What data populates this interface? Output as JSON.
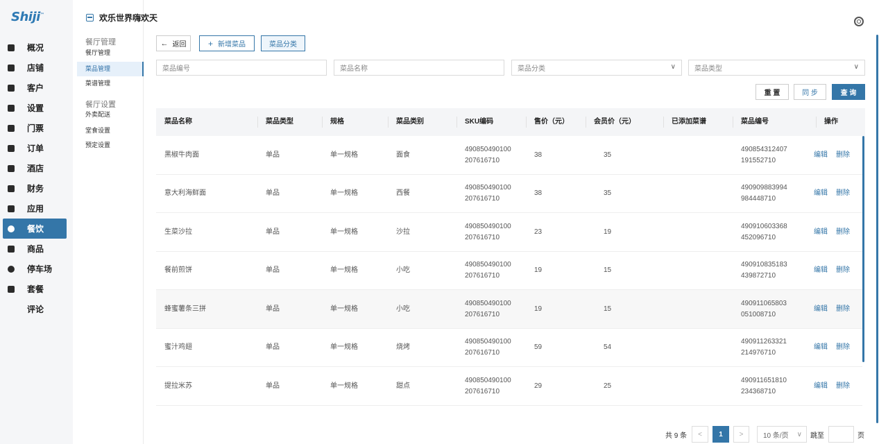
{
  "app": {
    "logo": "Shiji",
    "settings_icon": "gear-icon"
  },
  "nav": {
    "items": [
      {
        "label": "概况",
        "icon": "overview-icon",
        "active": false
      },
      {
        "label": "店铺",
        "icon": "store-icon",
        "active": false
      },
      {
        "label": "客户",
        "icon": "customer-icon",
        "active": false
      },
      {
        "label": "设置",
        "icon": "settings-icon",
        "active": false
      },
      {
        "label": "门票",
        "icon": "ticket-icon",
        "active": false
      },
      {
        "label": "订单",
        "icon": "order-icon",
        "active": false
      },
      {
        "label": "酒店",
        "icon": "hotel-icon",
        "active": false
      },
      {
        "label": "财务",
        "icon": "finance-icon",
        "active": false
      },
      {
        "label": "应用",
        "icon": "apps-icon",
        "active": false
      },
      {
        "label": "餐饮",
        "icon": "dining-icon",
        "active": true
      },
      {
        "label": "商品",
        "icon": "goods-icon",
        "active": false
      },
      {
        "label": "停车场",
        "icon": "parking-icon",
        "active": false
      },
      {
        "label": "套餐",
        "icon": "package-icon",
        "active": false
      },
      {
        "label": "评论",
        "icon": "",
        "active": false
      }
    ]
  },
  "page_title": "欢乐世界嗨欢天",
  "subnav": {
    "group1": {
      "title": "餐厅管理",
      "items": [
        "餐厅管理",
        "菜品管理",
        "菜谱管理"
      ],
      "active_index": 1
    },
    "group2": {
      "title": "餐厅设置",
      "items": [
        "外卖配送",
        "堂食设置",
        "预定设置"
      ]
    }
  },
  "toolbar": {
    "back_label": "返回",
    "add_label": "新增菜品",
    "category_label": "菜品分类"
  },
  "filters": {
    "code_placeholder": "菜品编号",
    "name_placeholder": "菜品名称",
    "category_placeholder": "菜品分类",
    "type_placeholder": "菜品类型"
  },
  "actions": {
    "reset_label": "重 置",
    "sync_label": "同 步",
    "query_label": "查 询"
  },
  "table": {
    "headers": [
      "菜品名称",
      "菜品类型",
      "规格",
      "菜品类别",
      "SKU编码",
      "售价（元）",
      "会员价（元）",
      "已添加菜谱",
      "菜品编号",
      "操作"
    ],
    "edit_label": "编辑",
    "delete_label": "删除",
    "rows": [
      {
        "name": "黑椒牛肉面",
        "type": "单品",
        "spec": "单一规格",
        "category": "面食",
        "sku_1": "490850490100",
        "sku_2": "207616710",
        "price": "38",
        "member_price": "35",
        "menu": "",
        "code_1": "490854312407",
        "code_2": "191552710"
      },
      {
        "name": "意大利海鲜面",
        "type": "单品",
        "spec": "单一规格",
        "category": "西餐",
        "sku_1": "490850490100",
        "sku_2": "207616710",
        "price": "38",
        "member_price": "35",
        "menu": "",
        "code_1": "490909883994",
        "code_2": "984448710"
      },
      {
        "name": "生菜沙拉",
        "type": "单品",
        "spec": "单一规格",
        "category": "沙拉",
        "sku_1": "490850490100",
        "sku_2": "207616710",
        "price": "23",
        "member_price": "19",
        "menu": "",
        "code_1": "490910603368",
        "code_2": "452096710"
      },
      {
        "name": "餐前煎饼",
        "type": "单品",
        "spec": "单一规格",
        "category": "小吃",
        "sku_1": "490850490100",
        "sku_2": "207616710",
        "price": "19",
        "member_price": "15",
        "menu": "",
        "code_1": "490910835183",
        "code_2": "439872710"
      },
      {
        "name": "蜂蜜薯条三拼",
        "type": "单品",
        "spec": "单一规格",
        "category": "小吃",
        "sku_1": "490850490100",
        "sku_2": "207616710",
        "price": "19",
        "member_price": "15",
        "menu": "",
        "code_1": "490911065803",
        "code_2": "051008710"
      },
      {
        "name": "蜜汁鸡翅",
        "type": "单品",
        "spec": "单一规格",
        "category": "烧烤",
        "sku_1": "490850490100",
        "sku_2": "207616710",
        "price": "59",
        "member_price": "54",
        "menu": "",
        "code_1": "490911263321",
        "code_2": "214976710"
      },
      {
        "name": "提拉米苏",
        "type": "单品",
        "spec": "单一规格",
        "category": "甜点",
        "sku_1": "490850490100",
        "sku_2": "207616710",
        "price": "29",
        "member_price": "25",
        "menu": "",
        "code_1": "490911651810",
        "code_2": "234368710"
      }
    ]
  },
  "pagination": {
    "total_text": "共 9 条",
    "current_page": "1",
    "prev": "<",
    "next": ">",
    "page_size": "10 条/页",
    "jump_label": "跳至",
    "page_suffix": "页"
  }
}
